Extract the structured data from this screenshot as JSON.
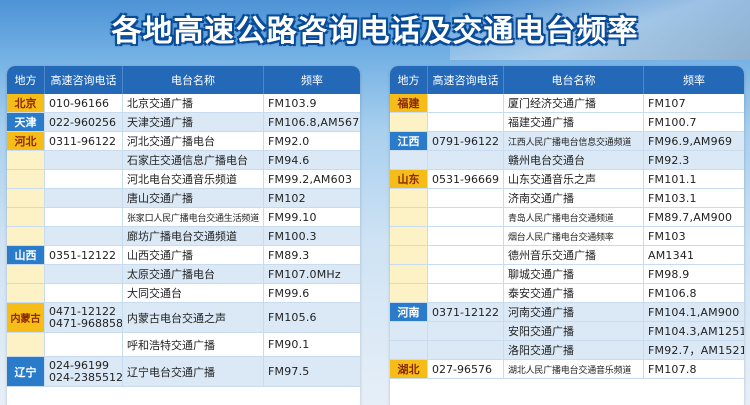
{
  "title": "各地高速公路咨询电话及交通电台频率",
  "headers": {
    "province": "地方",
    "phone": "高速咨询电话",
    "station": "电台名称",
    "freq": "频率"
  },
  "left_rows": [
    {
      "province": "北京",
      "phone": "010-96166",
      "station": "北京交通广播",
      "freq": "FM103.9"
    },
    {
      "province": "天津",
      "phone": "022-960256",
      "station": "天津交通广播",
      "freq": "FM106.8,AM567"
    },
    {
      "province": "河北",
      "phone": "0311-96122",
      "station": "河北交通广播电台",
      "freq": "FM92.0"
    },
    {
      "province": "",
      "phone": "",
      "station": "石家庄交通信息广播电台",
      "freq": "FM94.6"
    },
    {
      "province": "",
      "phone": "",
      "station": "河北电台交通音乐频道",
      "freq": "FM99.2,AM603"
    },
    {
      "province": "",
      "phone": "",
      "station": "唐山交通广播",
      "freq": "FM102"
    },
    {
      "province": "",
      "phone": "",
      "station": "张家口人民广播电台交通生活频道",
      "freq": "FM99.10"
    },
    {
      "province": "",
      "phone": "",
      "station": "廊坊广播电台交通频道",
      "freq": "FM100.3"
    },
    {
      "province": "山西",
      "phone": "0351-12122",
      "station": "山西交通广播",
      "freq": "FM89.3"
    },
    {
      "province": "",
      "phone": "",
      "station": "太原交通广播电台",
      "freq": "FM107.0MHz"
    },
    {
      "province": "",
      "phone": "",
      "station": "大同交通台",
      "freq": "FM99.6"
    },
    {
      "province": "内蒙古",
      "phone": "0471-12122",
      "phone2": "0471-968858",
      "station": "内蒙古电台交通之声",
      "freq": "FM105.6"
    },
    {
      "province": "",
      "phone": "",
      "station": "呼和浩特交通广播",
      "freq": "FM90.1"
    },
    {
      "province": "辽宁",
      "phone": "024-96199",
      "phone2": "024-23855123",
      "station": "辽宁电台交通广播",
      "freq": "FM97.5"
    }
  ],
  "right_rows": [
    {
      "province": "福建",
      "phone": "",
      "station": "厦门经济交通广播",
      "freq": "FM107"
    },
    {
      "province": "",
      "phone": "",
      "station": "福建交通广播",
      "freq": "FM100.7"
    },
    {
      "province": "江西",
      "phone": "0791-96122",
      "station": "江西人民广播电台信息交通频道",
      "freq": "FM96.9,AM969"
    },
    {
      "province": "",
      "phone": "",
      "station": "赣州电台交通台",
      "freq": "FM92.3"
    },
    {
      "province": "山东",
      "phone": "0531-96669",
      "station": "山东交通音乐之声",
      "freq": "FM101.1"
    },
    {
      "province": "",
      "phone": "",
      "station": "济南交通广播",
      "freq": "FM103.1"
    },
    {
      "province": "",
      "phone": "",
      "station": "青岛人民广播电台交通频道",
      "freq": "FM89.7,AM900"
    },
    {
      "province": "",
      "phone": "",
      "station": "烟台人民广播电台交通频率",
      "freq": "FM103"
    },
    {
      "province": "",
      "phone": "",
      "station": "德州音乐交通广播",
      "freq": "AM1341"
    },
    {
      "province": "",
      "phone": "",
      "station": "聊城交通广播",
      "freq": "FM98.9"
    },
    {
      "province": "",
      "phone": "",
      "station": "泰安交通广播",
      "freq": "FM106.8"
    },
    {
      "province": "河南",
      "phone": "0371-12122",
      "station": "河南交通广播",
      "freq": "FM104.1,AM900"
    },
    {
      "province": "",
      "phone": "",
      "station": "安阳交通广播",
      "freq": "FM104.3,AM1251"
    },
    {
      "province": "",
      "phone": "",
      "station": "洛阳交通广播",
      "freq": "FM92.7，AM1521"
    },
    {
      "province": "湖北",
      "phone": "027-96576",
      "station": "湖北人民广播电台交通音乐频道",
      "freq": "FM107.8"
    }
  ]
}
